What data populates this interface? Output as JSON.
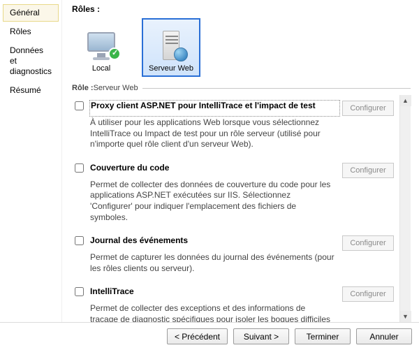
{
  "sidebar": {
    "items": [
      {
        "label": "Général"
      },
      {
        "label": "Rôles"
      },
      {
        "label": "Données et diagnostics"
      },
      {
        "label": "Résumé"
      }
    ],
    "selected_index": 0
  },
  "main": {
    "roles_label": "Rôles :",
    "roles": [
      {
        "name": "Local",
        "icon": "monitor"
      },
      {
        "name": "Serveur Web",
        "icon": "server-web"
      }
    ],
    "selected_role_index": 1,
    "role_fieldset_prefix": "Rôle :",
    "role_fieldset_role": "Serveur Web",
    "configure_label": "Configurer",
    "options": [
      {
        "title": "Proxy client ASP.NET pour IntelliTrace et l'impact de test",
        "description": "À utiliser pour les applications Web lorsque vous sélectionnez IntelliTrace ou Impact de test pour un rôle serveur (utilisé pour n'importe quel rôle client d'un serveur Web).",
        "checked": false,
        "focused": true
      },
      {
        "title": "Couverture du code",
        "description": "Permet de collecter des données de couverture du code pour les applications ASP.NET exécutées sur IIS. Sélectionnez 'Configurer' pour indiquer l'emplacement des fichiers de symboles.",
        "checked": false,
        "focused": false
      },
      {
        "title": "Journal des événements",
        "description": "Permet de capturer les données du journal des événements (pour les rôles clients ou serveur).",
        "checked": false,
        "focused": false
      },
      {
        "title": "IntelliTrace",
        "description": "Permet de collecter des exceptions et des informations de traçage de diagnostic spécifiques pour isoler les bogues difficiles à reproduire (rôles clients ou serveurs).",
        "checked": false,
        "focused": false
      }
    ]
  },
  "footer": {
    "back": "< Précédent",
    "next": "Suivant >",
    "finish": "Terminer",
    "cancel": "Annuler"
  }
}
